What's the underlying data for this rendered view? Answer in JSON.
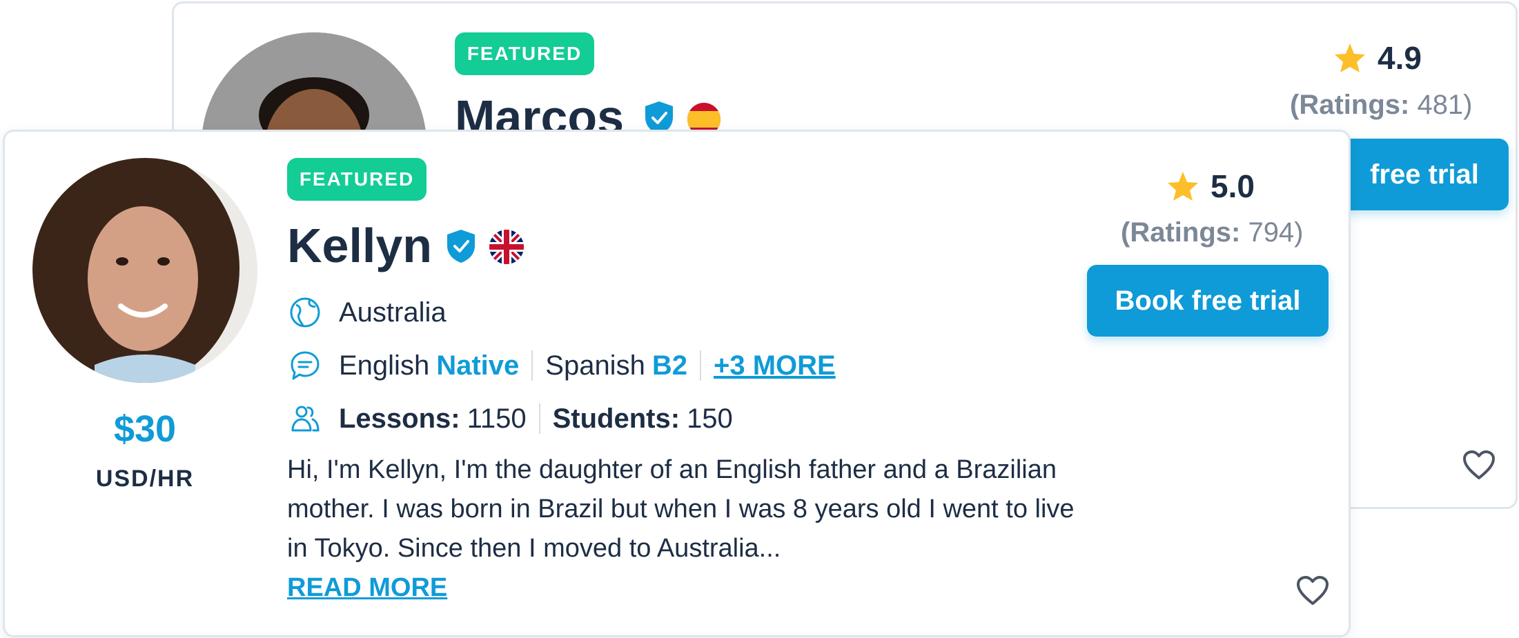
{
  "back_card": {
    "badge": "FEATURED",
    "name": "Marcos",
    "flag": "spain-flag",
    "rating": "4.9",
    "ratings_label": "(Ratings:",
    "ratings_count": " 481)",
    "button_label": "Book free trial",
    "button_visible_label": "free trial"
  },
  "front_card": {
    "badge": "FEATURED",
    "name": "Kellyn",
    "flag": "uk-flag",
    "country": "Australia",
    "languages": [
      {
        "name": "English",
        "level": "Native"
      },
      {
        "name": "Spanish",
        "level": "B2"
      }
    ],
    "more_languages": "+3 MORE",
    "lessons_label": "Lessons:",
    "lessons_value": "1150",
    "students_label": "Students:",
    "students_value": "150",
    "price": "$30",
    "price_unit": "USD/HR",
    "rating": "5.0",
    "ratings_label": "(Ratings:",
    "ratings_count": " 794)",
    "button_label": "Book free trial",
    "bio": "Hi, I'm Kellyn, I'm the daughter of an English  father and a Brazilian mother. I was born in Brazil but when I was 8 years old I went to live in Tokyo. Since then I moved to Australia...",
    "read_more": "READ MORE"
  },
  "colors": {
    "accent": "#0f9bd7",
    "featured": "#13cc96",
    "text": "#1d2d44",
    "muted": "#7c8797",
    "star": "#fcbf2a"
  },
  "icons": [
    "verified-shield-icon",
    "globe-icon",
    "chat-icon",
    "students-icon",
    "star-icon",
    "heart-icon"
  ]
}
